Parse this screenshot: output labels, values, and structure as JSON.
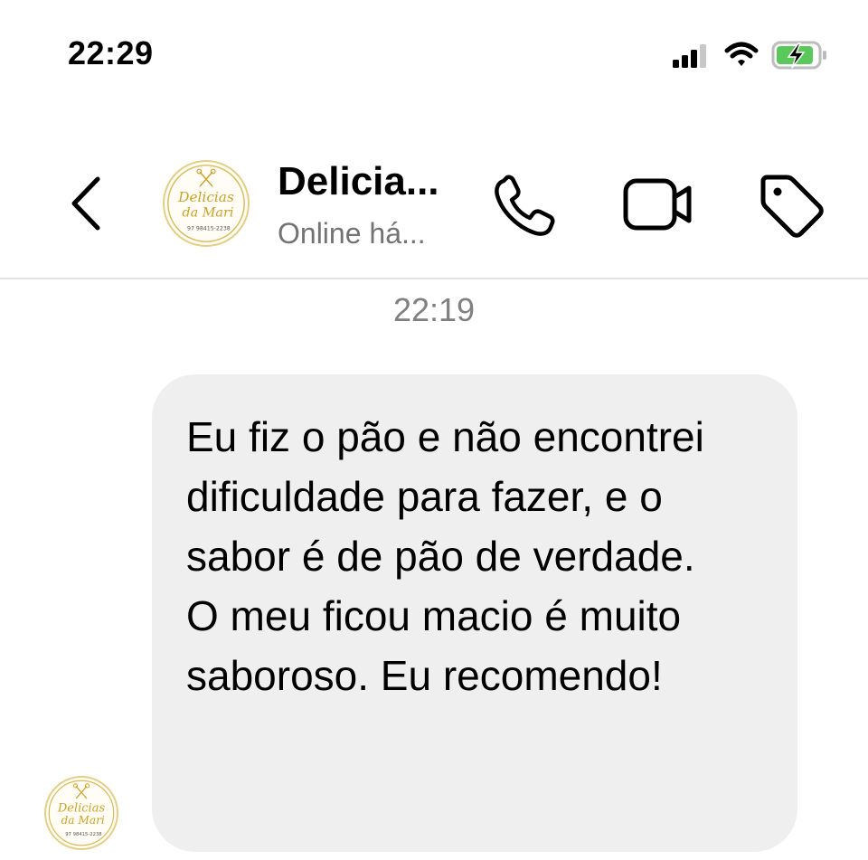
{
  "status_bar": {
    "time": "22:29"
  },
  "header": {
    "contact_name": "Delicia...",
    "contact_status": "Online há...",
    "avatar_logo": {
      "line1": "Delicias",
      "line2": "da Mari",
      "phone": "97 98415-2238"
    }
  },
  "chat": {
    "timestamp": "22:19",
    "message": {
      "paragraph1": "Eu fiz o pão e não encontrei dificuldade para fazer, e o sabor é de pão de verdade.",
      "paragraph2": "O meu ficou macio é muito saboroso. Eu recomendo!"
    }
  },
  "colors": {
    "bubble_bg": "#efefef",
    "secondary_text": "#737373",
    "timestamp_text": "#808080",
    "battery_green": "#5ac85a",
    "logo_gold": "#c9a227"
  },
  "icons": {
    "back": "chevron-left-icon",
    "call": "phone-icon",
    "video": "video-camera-icon",
    "tag": "tag-icon",
    "signal": "cellular-signal-icon",
    "wifi": "wifi-icon",
    "battery": "battery-charging-icon"
  }
}
